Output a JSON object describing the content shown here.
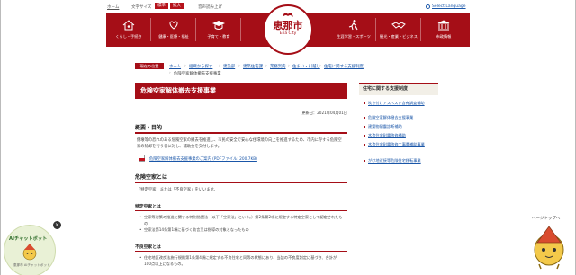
{
  "utility": {
    "home": "ホーム",
    "font_size_label": "文字サイズ",
    "font_standard": "標準",
    "font_large": "拡大",
    "voice": "音声読み上げ",
    "language": "Select Language"
  },
  "nav": {
    "items": [
      {
        "label": "くらし・手続き",
        "icon": "house-person-icon"
      },
      {
        "label": "健康・医療・福祉",
        "icon": "heart-hands-icon"
      },
      {
        "label": "子育て・教育",
        "icon": "graduation-cap-icon"
      },
      {
        "label": "生涯学習・スポーツ",
        "icon": "running-person-icon"
      },
      {
        "label": "観光・産業・ビジネス",
        "icon": "handshake-icon"
      },
      {
        "label": "市政情報",
        "icon": "city-hall-icon"
      }
    ],
    "logo": {
      "city_ja": "恵那市",
      "city_en": "Ena City"
    }
  },
  "breadcrumb": {
    "tag": "現在の位置",
    "items": [
      "ホーム",
      "組織から探す",
      "建設部",
      "建築住宅課",
      "業務案内",
      "住まい・引越し",
      "住宅に関する支援制度"
    ],
    "current": "危険空家解体撤去支援事業"
  },
  "article": {
    "title": "危険空家解体撤去支援事業",
    "updated": "更新日：2021年04月01日",
    "sections": {
      "overview_heading": "概要・目的",
      "overview_text": "倒壊等の恐れのある危険空家の撤去を推進し、市民の安全で安心な住環境の向上を推進するため、市内に存する危険空家の除却を行う者に対し、補助金を交付します。",
      "pdf_link": "危険空家解体撤去支援事業のご案内 (PDFファイル: 200.7KB)",
      "danger_heading": "危険空家とは",
      "danger_text": "「特定空家」または「不良空家」をいいます。",
      "tokutei_heading": "特定空家とは",
      "tokutei_items": [
        "空家等対策の推進に関する特別措置法（以下「空家法」という。）第2条第2項に規定する特定空家として認定されたもの",
        "空家法第14条第1項に基づく助言又は指導の対象となったもの"
      ],
      "furyo_heading": "不良空家とは",
      "furyo_items": [
        "住宅地区改良法施行規則第1条第4項に規定する不良住宅と同等の状態にあり、当該の不良度判定に基づき、合計が100点以上になるもの。"
      ]
    }
  },
  "sidebar": {
    "heading": "住宅に関する支援制度",
    "items": [
      "吹き付けアスベスト含有調査補助",
      "危険空家解体撤去支援事業",
      "建築物耐震診断補助",
      "木造住宅耐震改修補助",
      "木造住宅耐震改修工事費補助事業",
      "がけ地近接等危険住宅移転事業"
    ]
  },
  "chatbot": {
    "title": "AIチャットボット",
    "subtitle": "恵那市 AIチャットボット"
  },
  "pagetop": {
    "label": "ページトップへ"
  },
  "colors": {
    "brand_red": "#a50e17",
    "link_blue": "#1a56a8"
  }
}
